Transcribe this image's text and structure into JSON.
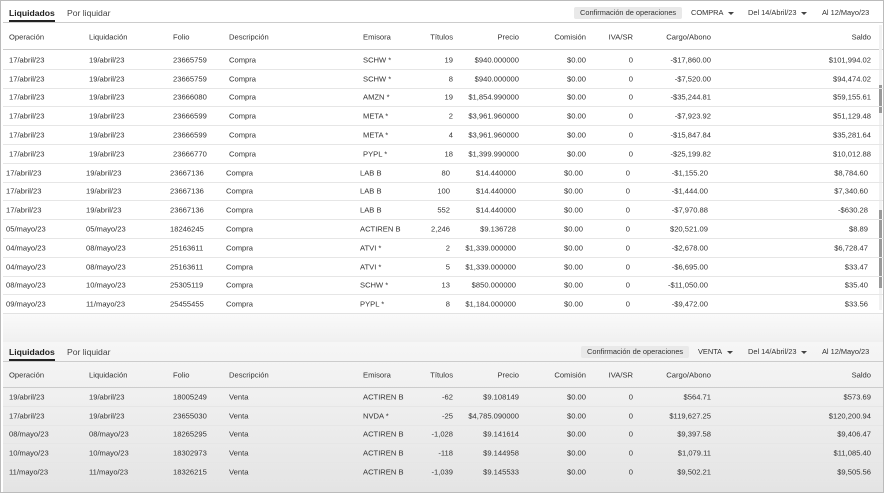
{
  "top": {
    "tabs": {
      "liquidados": "Liquidados",
      "por_liquidar": "Por liquidar"
    },
    "filters": {
      "confirmacion": "Confirmación de operaciones",
      "tipo": "COMPRA",
      "del": "Del 14/Abril/23",
      "al": "Al 12/Mayo/23"
    },
    "columns": [
      "Operación",
      "Liquidación",
      "Folio",
      "Descripción",
      "Emisora",
      "Títulos",
      "Precio",
      "Comisión",
      "IVA/SR",
      "Cargo/Abono",
      "Saldo"
    ],
    "rows": [
      [
        "17/abril/23",
        "19/abril/23",
        "23665759",
        "Compra",
        "SCHW *",
        "19",
        "$940.000000",
        "$0.00",
        "0",
        "-$17,860.00",
        "$101,994.02"
      ],
      [
        "17/abril/23",
        "19/abril/23",
        "23665759",
        "Compra",
        "SCHW *",
        "8",
        "$940.000000",
        "$0.00",
        "0",
        "-$7,520.00",
        "$94,474.02"
      ],
      [
        "17/abril/23",
        "19/abril/23",
        "23666080",
        "Compra",
        "AMZN *",
        "19",
        "$1,854.990000",
        "$0.00",
        "0",
        "-$35,244.81",
        "$59,155.61"
      ],
      [
        "17/abril/23",
        "19/abril/23",
        "23666599",
        "Compra",
        "META *",
        "2",
        "$3,961.960000",
        "$0.00",
        "0",
        "-$7,923.92",
        "$51,129.48"
      ],
      [
        "17/abril/23",
        "19/abril/23",
        "23666599",
        "Compra",
        "META *",
        "4",
        "$3,961.960000",
        "$0.00",
        "0",
        "-$15,847.84",
        "$35,281.64"
      ],
      [
        "17/abril/23",
        "19/abril/23",
        "23666770",
        "Compra",
        "PYPL *",
        "18",
        "$1,399.990000",
        "$0.00",
        "0",
        "-$25,199.82",
        "$10,012.88"
      ],
      [
        "17/abril/23",
        "19/abril/23",
        "23667136",
        "Compra",
        "LAB B",
        "80",
        "$14.440000",
        "$0.00",
        "0",
        "-$1,155.20",
        "$8,784.60"
      ],
      [
        "17/abril/23",
        "19/abril/23",
        "23667136",
        "Compra",
        "LAB B",
        "100",
        "$14.440000",
        "$0.00",
        "0",
        "-$1,444.00",
        "$7,340.60"
      ],
      [
        "17/abril/23",
        "19/abril/23",
        "23667136",
        "Compra",
        "LAB B",
        "552",
        "$14.440000",
        "$0.00",
        "0",
        "-$7,970.88",
        "-$630.28"
      ],
      [
        "05/mayo/23",
        "05/mayo/23",
        "18246245",
        "Compra",
        "ACTIREN B",
        "2,246",
        "$9.136728",
        "$0.00",
        "0",
        "$20,521.09",
        "$8.89"
      ],
      [
        "04/mayo/23",
        "08/mayo/23",
        "25163611",
        "Compra",
        "ATVI *",
        "2",
        "$1,339.000000",
        "$0.00",
        "0",
        "-$2,678.00",
        "$6,728.47"
      ],
      [
        "04/mayo/23",
        "08/mayo/23",
        "25163611",
        "Compra",
        "ATVI *",
        "5",
        "$1,339.000000",
        "$0.00",
        "0",
        "-$6,695.00",
        "$33.47"
      ],
      [
        "08/mayo/23",
        "10/mayo/23",
        "25305119",
        "Compra",
        "SCHW *",
        "13",
        "$850.000000",
        "$0.00",
        "0",
        "-$11,050.00",
        "$35.40"
      ],
      [
        "09/mayo/23",
        "11/mayo/23",
        "25455455",
        "Compra",
        "PYPL *",
        "8",
        "$1,184.000000",
        "$0.00",
        "0",
        "-$9,472.00",
        "$33.56"
      ]
    ]
  },
  "bottom": {
    "tabs": {
      "liquidados": "Liquidados",
      "por_liquidar": "Por liquidar"
    },
    "filters": {
      "confirmacion": "Confirmación de operaciones",
      "tipo": "VENTA",
      "del": "Del 14/Abril/23",
      "al": "Al 12/Mayo/23"
    },
    "columns": [
      "Operación",
      "Liquidación",
      "Folio",
      "Descripción",
      "Emisora",
      "Títulos",
      "Precio",
      "Comisión",
      "IVA/SR",
      "Cargo/Abono",
      "Saldo"
    ],
    "rows": [
      [
        "19/abril/23",
        "19/abril/23",
        "18005249",
        "Venta",
        "ACTIREN B",
        "-62",
        "$9.108149",
        "$0.00",
        "0",
        "$564.71",
        "$573.69"
      ],
      [
        "17/abril/23",
        "19/abril/23",
        "23655030",
        "Venta",
        "NVDA *",
        "-25",
        "$4,785.090000",
        "$0.00",
        "0",
        "$119,627.25",
        "$120,200.94"
      ],
      [
        "08/mayo/23",
        "08/mayo/23",
        "18265295",
        "Venta",
        "ACTIREN B",
        "-1,028",
        "$9.141614",
        "$0.00",
        "0",
        "$9,397.58",
        "$9,406.47"
      ],
      [
        "10/mayo/23",
        "10/mayo/23",
        "18302973",
        "Venta",
        "ACTIREN B",
        "-118",
        "$9.144958",
        "$0.00",
        "0",
        "$1,079.11",
        "$11,085.40"
      ],
      [
        "11/mayo/23",
        "11/mayo/23",
        "18326215",
        "Venta",
        "ACTIREN B",
        "-1,039",
        "$9.145533",
        "$0.00",
        "0",
        "$9,502.21",
        "$9,505.56"
      ]
    ]
  }
}
